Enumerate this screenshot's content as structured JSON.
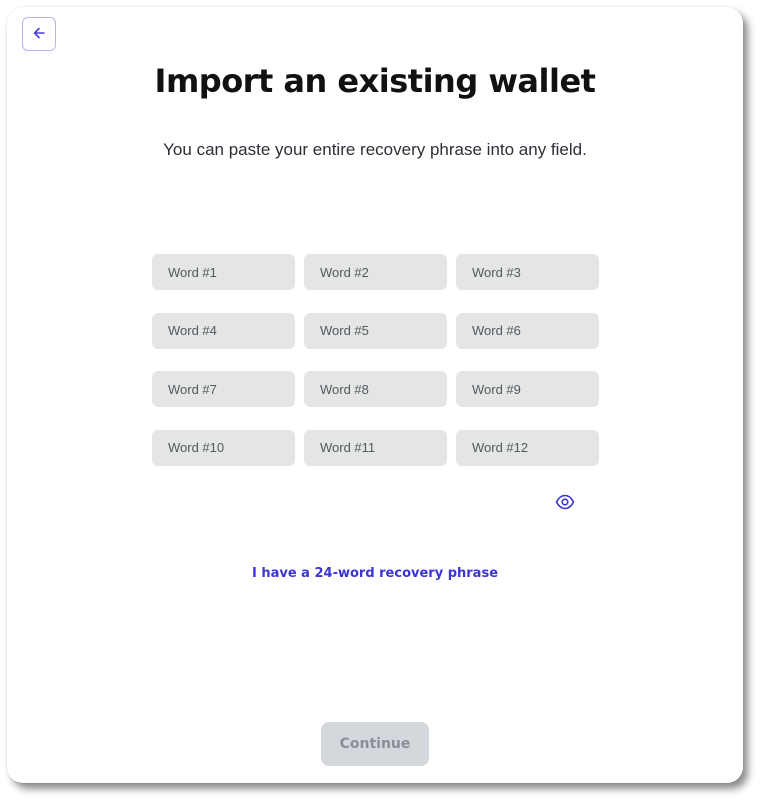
{
  "header": {
    "back_icon": "arrow-left-icon",
    "title": "Import an existing wallet",
    "subtitle": "You can paste your entire recovery phrase into any field."
  },
  "phrase": {
    "words": [
      {
        "placeholder": "Word #1",
        "value": ""
      },
      {
        "placeholder": "Word #2",
        "value": ""
      },
      {
        "placeholder": "Word #3",
        "value": ""
      },
      {
        "placeholder": "Word #4",
        "value": ""
      },
      {
        "placeholder": "Word #5",
        "value": ""
      },
      {
        "placeholder": "Word #6",
        "value": ""
      },
      {
        "placeholder": "Word #7",
        "value": ""
      },
      {
        "placeholder": "Word #8",
        "value": ""
      },
      {
        "placeholder": "Word #9",
        "value": ""
      },
      {
        "placeholder": "Word #10",
        "value": ""
      },
      {
        "placeholder": "Word #11",
        "value": ""
      },
      {
        "placeholder": "Word #12",
        "value": ""
      }
    ],
    "visibility_icon": "eye-icon"
  },
  "links": {
    "switch_length": "I have a 24-word recovery phrase"
  },
  "footer": {
    "continue_label": "Continue"
  },
  "colors": {
    "accent": "#3b35d6",
    "input_bg": "#e4e5e5",
    "button_disabled_bg": "#d4d7dc",
    "button_disabled_text": "#8a8f97"
  }
}
